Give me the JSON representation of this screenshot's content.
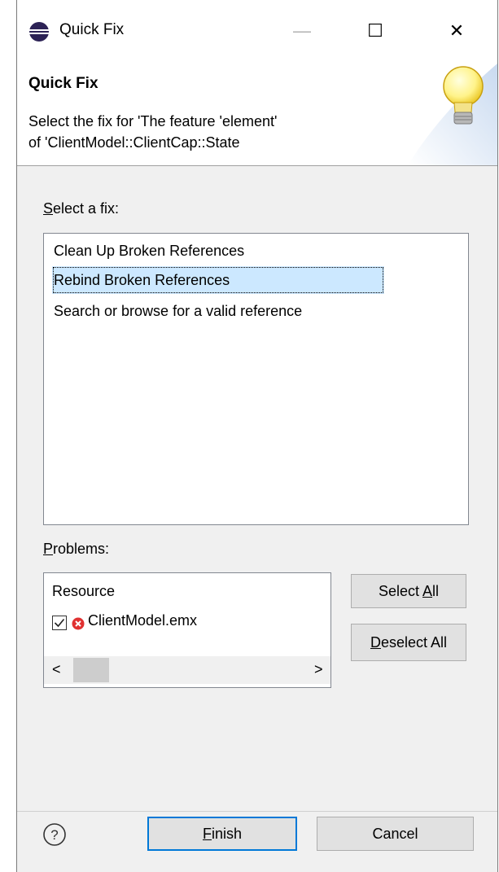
{
  "window": {
    "title": "Quick Fix",
    "minimize_glyph": "—",
    "maximize_glyph": "☐",
    "close_glyph": "✕"
  },
  "header": {
    "title": "Quick Fix",
    "description_line1": "Select the fix for 'The feature 'element'",
    "description_line2": "of 'ClientModel::ClientCap::State"
  },
  "fixes": {
    "label_mnemonic": "S",
    "label_rest": "elect a fix:",
    "items": [
      "Clean Up Broken References",
      "Rebind Broken References",
      "Search or browse for a valid reference"
    ],
    "selected_index": 1
  },
  "problems": {
    "label_mnemonic": "P",
    "label_rest": "roblems:",
    "column_header": "Resource",
    "rows": [
      {
        "checked": true,
        "status": "error",
        "name": "ClientModel.emx"
      }
    ],
    "scroll_left": "<",
    "scroll_right": ">"
  },
  "buttons": {
    "select_all_prefix": "Select ",
    "select_all_mnemonic": "A",
    "select_all_suffix": "ll",
    "deselect_all_mnemonic": "D",
    "deselect_all_suffix": "eselect All",
    "finish_mnemonic": "F",
    "finish_suffix": "inish",
    "cancel": "Cancel",
    "help_glyph": "?"
  },
  "icons": {
    "app_icon": "eclipse-icon",
    "header_icon": "lightbulb-icon",
    "error_icon": "error-icon",
    "checkbox_icon": "checkbox-checked-icon",
    "help_icon": "help-icon"
  },
  "colors": {
    "selection": "#cce8ff",
    "default_button_border": "#0078d7",
    "error": "#e03131",
    "app_icon": "#2c2255"
  }
}
